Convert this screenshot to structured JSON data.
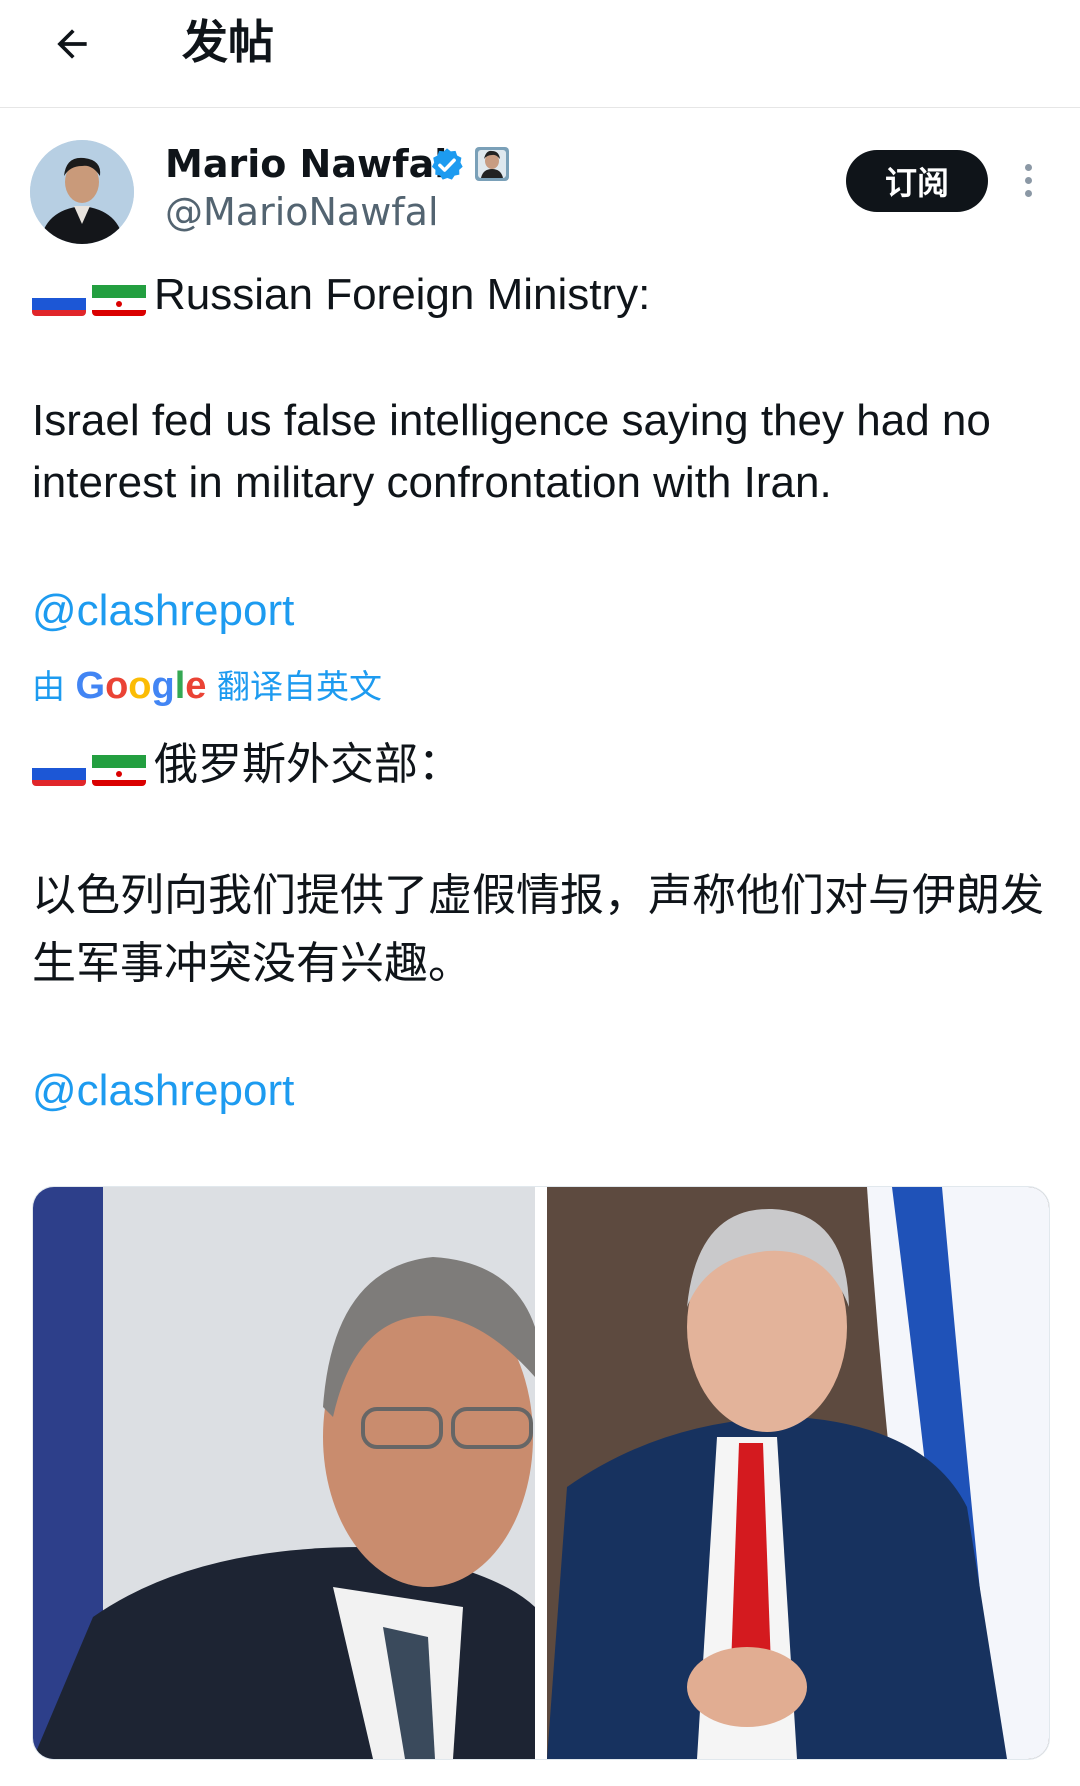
{
  "header": {
    "title": "发帖"
  },
  "post": {
    "display_name": "Mario Nawfal",
    "handle": "@MarioNawfal",
    "subscribe_label": "订阅",
    "original_heading": "Russian Foreign Ministry:",
    "original_body": "Israel fed us false intelligence saying they had no interest in military confrontation with Iran.",
    "original_mention": "@clashreport",
    "translation_prefix": "由",
    "translation_brand": "Google",
    "translation_suffix": "翻译自英文",
    "translated_heading": "俄罗斯外交部：",
    "translated_body": "以色列向我们提供了虚假情报，声称他们对与伊朗发生军事冲突没有兴趣。",
    "translated_mention": "@clashreport"
  },
  "colors": {
    "link": "#1d9bf0",
    "verified": "#1d9bf0",
    "button": "#0f1419",
    "muted": "#536471"
  },
  "icons": [
    "back-arrow-icon",
    "verified-icon",
    "affiliate-badge-icon",
    "more-icon",
    "russia-flag-icon",
    "iran-flag-icon"
  ]
}
